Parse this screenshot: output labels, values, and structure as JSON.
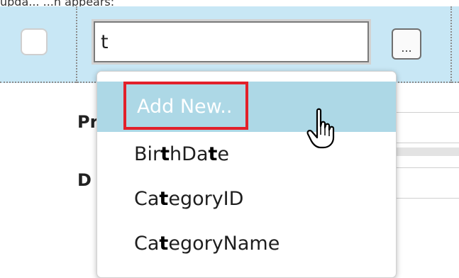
{
  "caption": "upda... ...n appears:",
  "row": {
    "search_value": "t",
    "ellipsis_label": "..."
  },
  "background_labels": {
    "label1": "Pr",
    "label2": "D"
  },
  "dropdown": {
    "items": [
      {
        "label": "Add New..",
        "highlighted": true
      },
      {
        "parts": [
          "Bir",
          "t",
          "hDa",
          "t",
          "e"
        ]
      },
      {
        "parts": [
          "Ca",
          "t",
          "egoryID"
        ]
      },
      {
        "parts": [
          "Ca",
          "t",
          "egoryName"
        ]
      }
    ]
  },
  "colors": {
    "row_highlight": "#c8e7f5",
    "item_highlight": "#add8e6",
    "annotation_box": "#e2202a"
  },
  "icons": {
    "cursor": "hand-pointer-icon"
  }
}
